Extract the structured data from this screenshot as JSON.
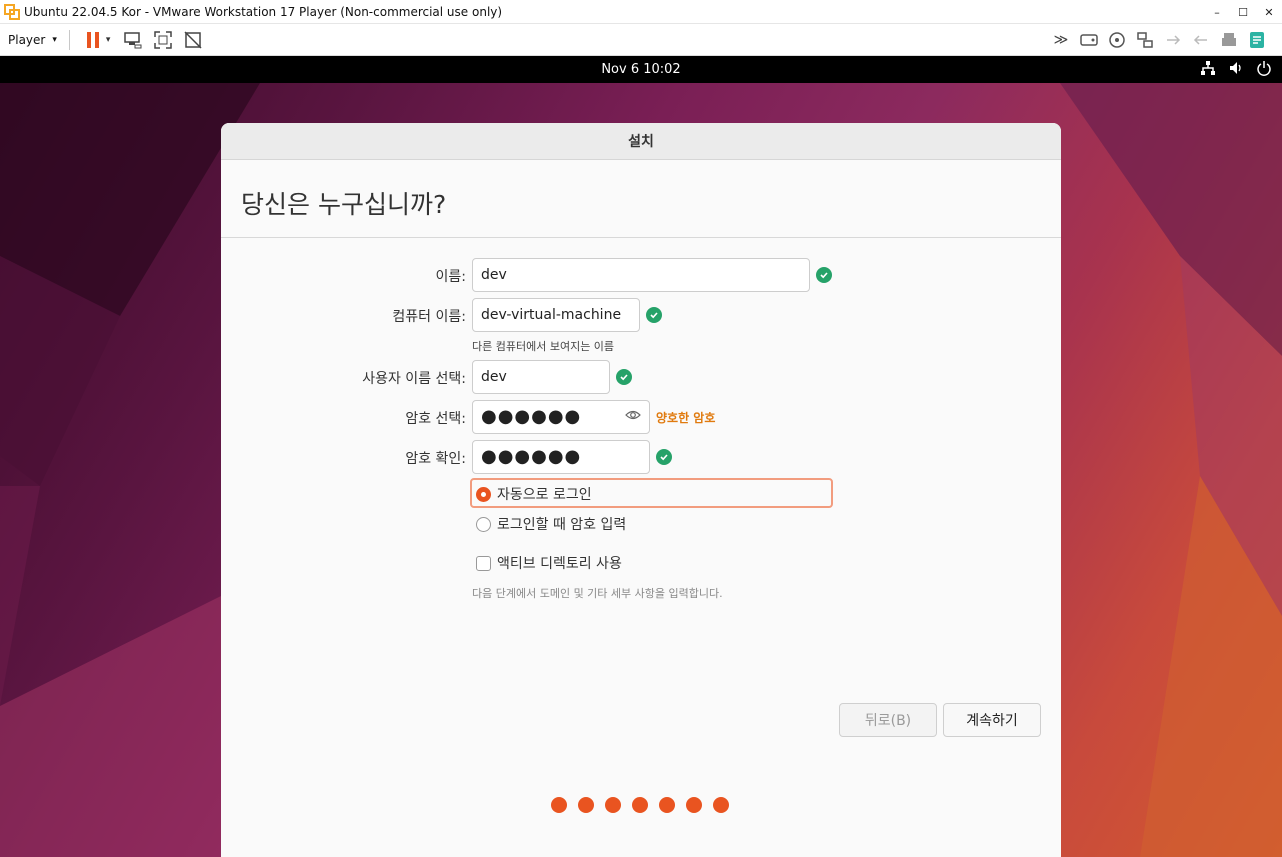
{
  "window": {
    "title": "Ubuntu 22.04.5 Kor - VMware Workstation 17 Player (Non-commercial use only)",
    "controls": {
      "minimize": "–",
      "maximize": "☐",
      "close": "✕"
    }
  },
  "toolbar": {
    "player_label": "Player",
    "player_caret": "▾",
    "pause_caret": "▾",
    "overflow_label": "≫"
  },
  "topbar": {
    "clock": "Nov 6  10:02"
  },
  "installer": {
    "window_title": "설치",
    "heading": "당신은 누구십니까?",
    "name": {
      "label": "이름:",
      "value": "dev"
    },
    "computer_name": {
      "label": "컴퓨터 이름:",
      "value": "dev-virtual-machine",
      "hint": "다른 컴퓨터에서 보여지는 이름"
    },
    "username": {
      "label": "사용자 이름 선택:",
      "value": "dev"
    },
    "password": {
      "label": "암호 선택:",
      "masked": "●●●●●●",
      "strength": "양호한 암호"
    },
    "confirm_password": {
      "label": "암호 확인:",
      "masked": "●●●●●●"
    },
    "login_options": {
      "auto_login": "자동으로 로그인",
      "require_password": "로그인할 때 암호 입력",
      "selected": "auto_login"
    },
    "active_directory": {
      "label": "액티브 디렉토리 사용",
      "hint": "다음 단계에서 도메인 및 기타 세부 사항을 입력합니다.",
      "checked": false
    },
    "buttons": {
      "back": "뒤로(B)",
      "continue": "계속하기"
    },
    "progress": {
      "steps": 7,
      "current": 7
    }
  },
  "colors": {
    "accent": "#e95420",
    "valid": "#26a269",
    "strength_text": "#e07a0e",
    "focus_border": "#f29c7e"
  }
}
